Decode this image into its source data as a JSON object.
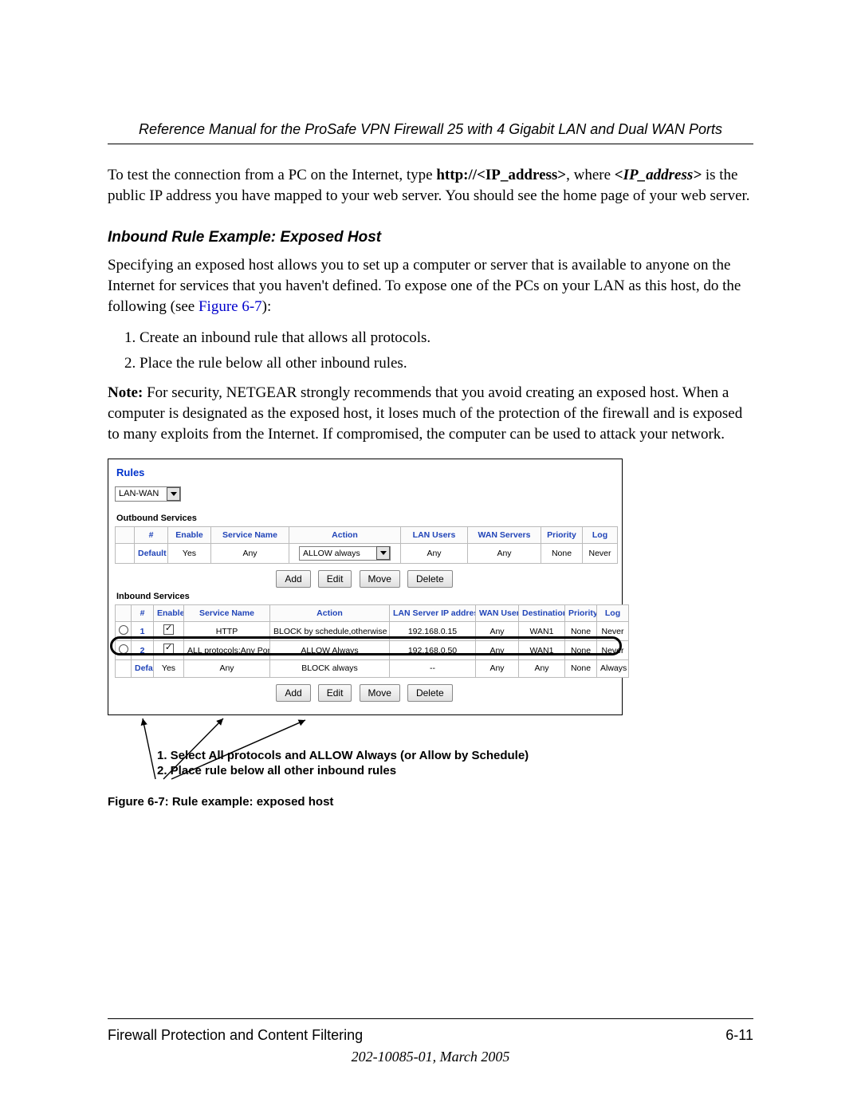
{
  "header": {
    "title": "Reference Manual for the ProSafe VPN Firewall 25 with 4 Gigabit LAN and Dual WAN Ports"
  },
  "intro": {
    "pre": "To test the connection from a PC on the Internet, type ",
    "url": "http://<IP_address>",
    "mid": ", where ",
    "ipvar": "<IP_address>",
    "post": " is the public IP address you have mapped to your web server. You should see the home page of your web server."
  },
  "subheading": "Inbound Rule Example: Exposed Host",
  "para2": {
    "pre": "Specifying an exposed host allows you to set up a computer or server that is available to anyone on the Internet for services that you haven't defined. To expose one of the PCs on your LAN as this host, do the following (see ",
    "xref": "Figure 6-7",
    "post": "):"
  },
  "steps": [
    "Create an inbound rule that allows all protocols.",
    "Place the rule below all other inbound rules."
  ],
  "note": {
    "label": "Note:",
    "text": " For security, NETGEAR strongly recommends that you avoid creating an exposed host. When a computer is designated as the exposed host, it loses much of the protection of the firewall and is exposed to many exploits from the Internet. If compromised, the computer can be used to attack your network."
  },
  "screenshot": {
    "title": "Rules",
    "lanwan_select": "LAN-WAN",
    "outbound_label": "Outbound Services",
    "inbound_label": "Inbound Services",
    "outbound_headers": [
      "",
      "#",
      "Enable",
      "Service Name",
      "Action",
      "LAN Users",
      "WAN Servers",
      "Priority",
      "Log"
    ],
    "outbound_rows": [
      {
        "radio": "",
        "num": "Default",
        "enable": "Yes",
        "service": "Any",
        "action_select": "ALLOW always",
        "lan": "Any",
        "wan": "Any",
        "priority": "None",
        "log": "Never"
      }
    ],
    "inbound_headers": [
      "",
      "#",
      "Enable",
      "Service Name",
      "Action",
      "LAN Server IP address",
      "WAN Users",
      "Destination",
      "Priority",
      "Log"
    ],
    "inbound_rows": [
      {
        "num": "1",
        "enable": true,
        "service": "HTTP",
        "action": "BLOCK by schedule,otherwise allow",
        "lanip": "192.168.0.15",
        "wan": "Any",
        "dest": "WAN1",
        "priority": "None",
        "log": "Never"
      },
      {
        "num": "2",
        "enable": true,
        "service": "ALL protocols:Any Port",
        "action": "ALLOW Always",
        "lanip": "192.168.0.50",
        "wan": "Any",
        "dest": "WAN1",
        "priority": "None",
        "log": "Never"
      },
      {
        "num": "Default",
        "enable_text": "Yes",
        "service": "Any",
        "action": "BLOCK always",
        "lanip": "--",
        "wan": "Any",
        "dest": "Any",
        "priority": "None",
        "log": "Always"
      }
    ],
    "buttons": [
      "Add",
      "Edit",
      "Move",
      "Delete"
    ]
  },
  "annotation": {
    "line1": "1. Select All protocols and ALLOW Always (or Allow by Schedule)",
    "line2": "2. Place rule below all other inbound rules"
  },
  "caption": "Figure 6-7:  Rule example: exposed host",
  "footer": {
    "section": "Firewall Protection and Content Filtering",
    "pagenum": "6-11",
    "docid": "202-10085-01, March 2005"
  }
}
